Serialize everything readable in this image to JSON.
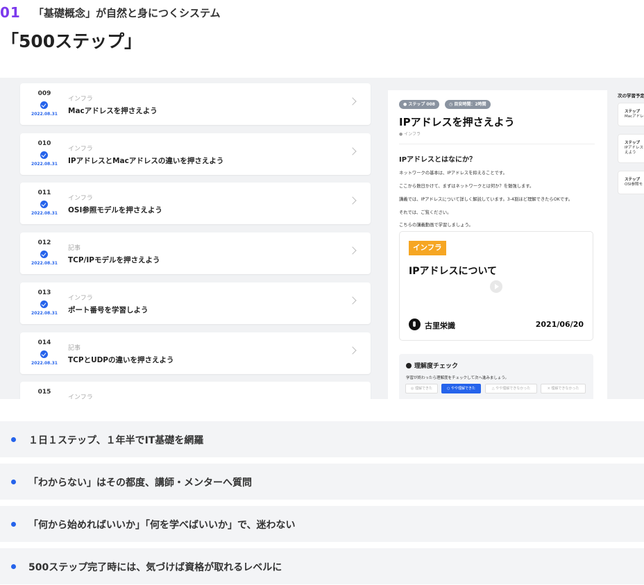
{
  "heading": {
    "number": "01",
    "subtitle": "「基礎概念」が自然と身につくシステム",
    "title": "「500ステップ」"
  },
  "steps": [
    {
      "num": "009",
      "date": "2022.08.31",
      "category": "インフラ",
      "title": "Macアドレスを押さえよう"
    },
    {
      "num": "010",
      "date": "2022.08.31",
      "category": "インフラ",
      "title": "IPアドレスとMacアドレスの違いを押さえよう"
    },
    {
      "num": "011",
      "date": "2022.08.31",
      "category": "インフラ",
      "title": "OSI参照モデルを押さえよう"
    },
    {
      "num": "012",
      "date": "2022.08.31",
      "category": "記事",
      "title": "TCP/IPモデルを押さえよう"
    },
    {
      "num": "013",
      "date": "2022.08.31",
      "category": "インフラ",
      "title": "ポート番号を学習しよう"
    },
    {
      "num": "014",
      "date": "2022.08.31",
      "category": "記事",
      "title": "TCPとUDPの違いを押さえよう"
    },
    {
      "num": "015",
      "date": "",
      "category": "インフラ",
      "title": ""
    }
  ],
  "detail": {
    "badge_step": "ステップ 008",
    "badge_time": "目安時間：2時間",
    "title": "IPアドレスを押さえよう",
    "tag": "インフラ",
    "section_heading": "IPアドレスとはなにか？",
    "paragraphs": [
      "ネットワークの基本は、IPアドレスを抑えることです。",
      "ここから数日かけて、まずはネットワークとは何か？を勉強します。",
      "講義では、IPアドレスについて詳しく解説しています。3-4割ほど理解できたらOKです。",
      "それでは、ご覧ください。",
      "こちらの講義動画で学習しましょう。"
    ],
    "video": {
      "tag": "インフラ",
      "title": "IPアドレスについて",
      "author": "古里栄識",
      "date": "2021/06/20"
    },
    "check": {
      "title": "理解度チェック",
      "subtitle": "学習が終わったら理解度をチェックして次へ進みましょう。",
      "options": [
        "◎ 理解できた",
        "○ やや理解できた",
        "△ やや理解できなかった",
        "× 理解できなかった"
      ]
    }
  },
  "next": {
    "title": "次の学習予定",
    "items": [
      {
        "label": "ステップ",
        "text": "Macアドレ"
      },
      {
        "label": "ステップ",
        "text": "IPアドレス\nえよう"
      },
      {
        "label": "ステップ",
        "text": "OSI参照モ"
      }
    ]
  },
  "features": [
    "１日１ステップ、１年半でIT基礎を網羅",
    "「わからない」はその都度、講師・メンターへ質問",
    "「何から始めればいいか」「何を学べばいいか」で、迷わない",
    "500ステップ完了時には、気づけば資格が取れるレベルに"
  ]
}
